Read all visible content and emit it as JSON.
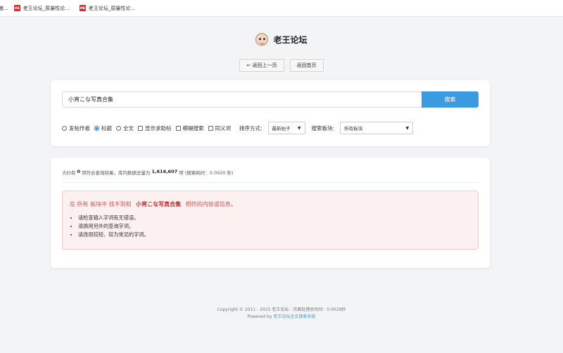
{
  "bookmarks": [
    {
      "label": "傲...",
      "favicon": "MB"
    },
    {
      "label": "老王论坛_原屡性论...",
      "favicon": "MB"
    },
    {
      "label": "老王论坛_原屡性论...",
      "favicon": "MB"
    }
  ],
  "header": {
    "title": "老王论坛",
    "back_label": "← 返回上一页",
    "home_label": "返回首页"
  },
  "search": {
    "query": "小宵こな写真合集",
    "button_label": "搜索",
    "options": {
      "author": "发帖作者",
      "title": "标题",
      "fulltext": "全文",
      "show_help": "显示求助帖",
      "fuzzy": "模糊搜索",
      "synonym": "同义词"
    },
    "sort_label": "排序方式:",
    "sort_value": "最新帖子",
    "board_label": "搜索板块:",
    "board_value": "所有板块"
  },
  "results": {
    "summary_prefix": "大约有",
    "count": "0",
    "summary_mid": "项符合查询结果，库内数据总量为",
    "total": "1,616,607",
    "summary_suffix": "项 (搜索耗时：0.0020 秒)",
    "alert": {
      "prefix": "在 所有 板块中 找不到和",
      "keyword": "小宵こな写真合集",
      "suffix": "相符的内容或信息。",
      "tips": [
        "请检查输入字词有无错误。",
        "请换用另外的查询字词。",
        "请改用较短、较为常见的字词。"
      ]
    }
  },
  "footer": {
    "copyright": "Copyright © 2011 - 2025 老王论坛 - 页面处理总时间：0.0029秒",
    "powered_prefix": "Powered by",
    "powered_link": "老王论坛全文搜索系统"
  },
  "colors": {
    "accent": "#3a9be0",
    "alert_text": "#d9534f",
    "alert_bg": "#fdf0f0"
  }
}
